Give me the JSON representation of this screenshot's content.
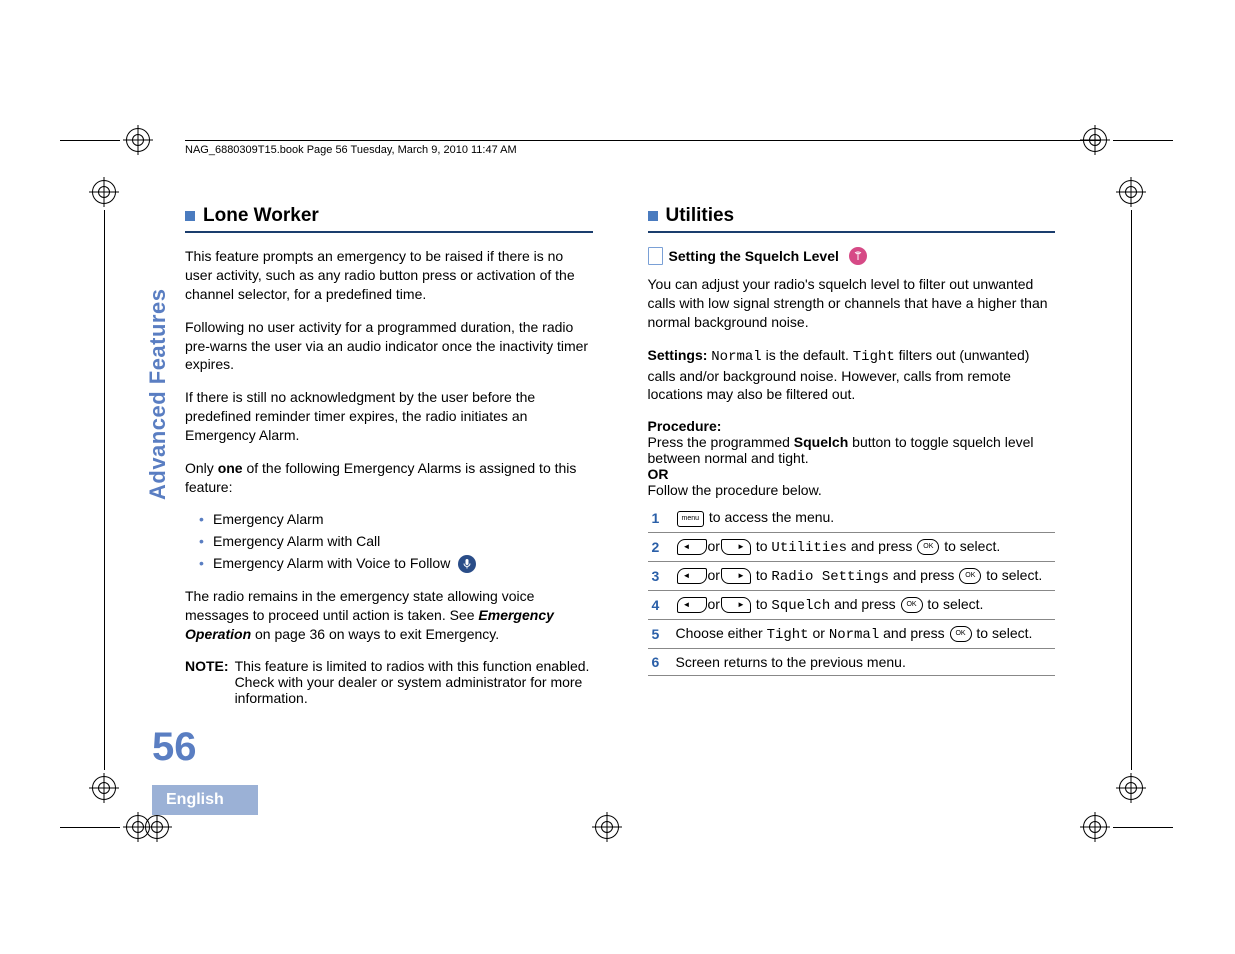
{
  "running_header": "NAG_6880309T15.book  Page 56  Tuesday, March 9, 2010  11:47 AM",
  "side_label": "Advanced Features",
  "page_number": "56",
  "language_tab": "English",
  "left": {
    "heading": "Lone Worker",
    "p1": "This feature prompts an emergency to be raised if there is no user activity, such as any radio button press or activation of the channel selector, for a predefined time.",
    "p2": "Following no user activity for a programmed duration, the radio pre-warns the user via an audio indicator once the inactivity timer expires.",
    "p3": "If there is still no acknowledgment by the user before the predefined reminder timer expires, the radio initiates an Emergency Alarm.",
    "p4_a": "Only ",
    "p4_b": "one",
    "p4_c": " of the following Emergency Alarms is assigned to this feature:",
    "bullets": {
      "b1": "Emergency Alarm",
      "b2": "Emergency Alarm with Call",
      "b3": "Emergency Alarm with Voice to Follow"
    },
    "p5_a": "The radio remains in the emergency state allowing voice messages to proceed until action is taken. See ",
    "p5_b": "Emergency Operation",
    "p5_c": " on page 36 on ways to exit Emergency.",
    "note_label": "NOTE:",
    "note_text": "This feature is limited to radios with this function enabled. Check with your dealer or system administrator for more information."
  },
  "right": {
    "heading": "Utilities",
    "sub_heading": "Setting the Squelch Level",
    "p1": "You can adjust your radio's squelch level to filter out unwanted calls with low signal strength or channels that have a higher than normal background noise.",
    "settings_label": "Settings: ",
    "settings_normal": "Normal",
    "settings_mid": " is the default. ",
    "settings_tight": "Tight",
    "settings_rest": " filters out (unwanted) calls and/or background noise. However, calls from remote locations may also be filtered out.",
    "procedure_label": "Procedure:",
    "proc_a": "Press the programmed ",
    "proc_b": "Squelch",
    "proc_c": " button to toggle squelch level between normal and tight.",
    "or_label": "OR",
    "or_text": "Follow the procedure below.",
    "steps": {
      "s1": " to access the menu.",
      "s2_to": " to ",
      "s2_target": "Utilities",
      "s2_mid": " and press ",
      "s2_end": " to select.",
      "s3_target": "Radio Settings",
      "s4_target": "Squelch",
      "s5_a": "Choose either ",
      "s5_tight": "Tight",
      "s5_or": " or ",
      "s5_normal": "Normal",
      "s5_mid": " and press ",
      "s5_end": " to select.",
      "s6": "Screen returns to the previous menu."
    },
    "key_menu": "menu",
    "key_ok": "OK"
  }
}
